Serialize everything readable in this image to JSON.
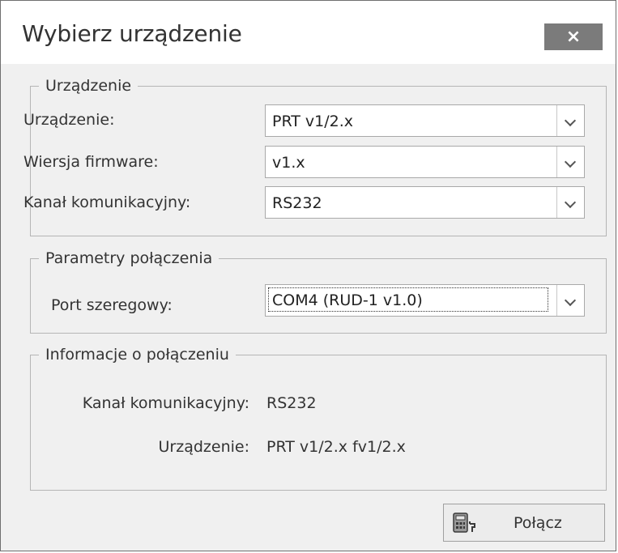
{
  "window": {
    "title": "Wybierz urządzenie",
    "close_label": "×"
  },
  "device_group": {
    "title": "Urządzenie",
    "device_label": "Urządzenie:",
    "device_value": "PRT v1/2.x",
    "firmware_label": "Wiersja firmware:",
    "firmware_value": "v1.x",
    "channel_label": "Kanał komunikacyjny:",
    "channel_value": "RS232"
  },
  "connection_params": {
    "title": "Parametry połączenia",
    "port_label": "Port szeregowy:",
    "port_value": "COM4 (RUD-1 v1.0)"
  },
  "connection_info": {
    "title": "Informacje o połączeniu",
    "channel_label": "Kanał komunikacyjny:",
    "channel_value": "RS232",
    "device_label": "Urządzenie:",
    "device_value": "PRT v1/2.x fv1/2.x"
  },
  "actions": {
    "connect_label": "Połącz",
    "connect_icon": "calculator-connect-icon"
  }
}
